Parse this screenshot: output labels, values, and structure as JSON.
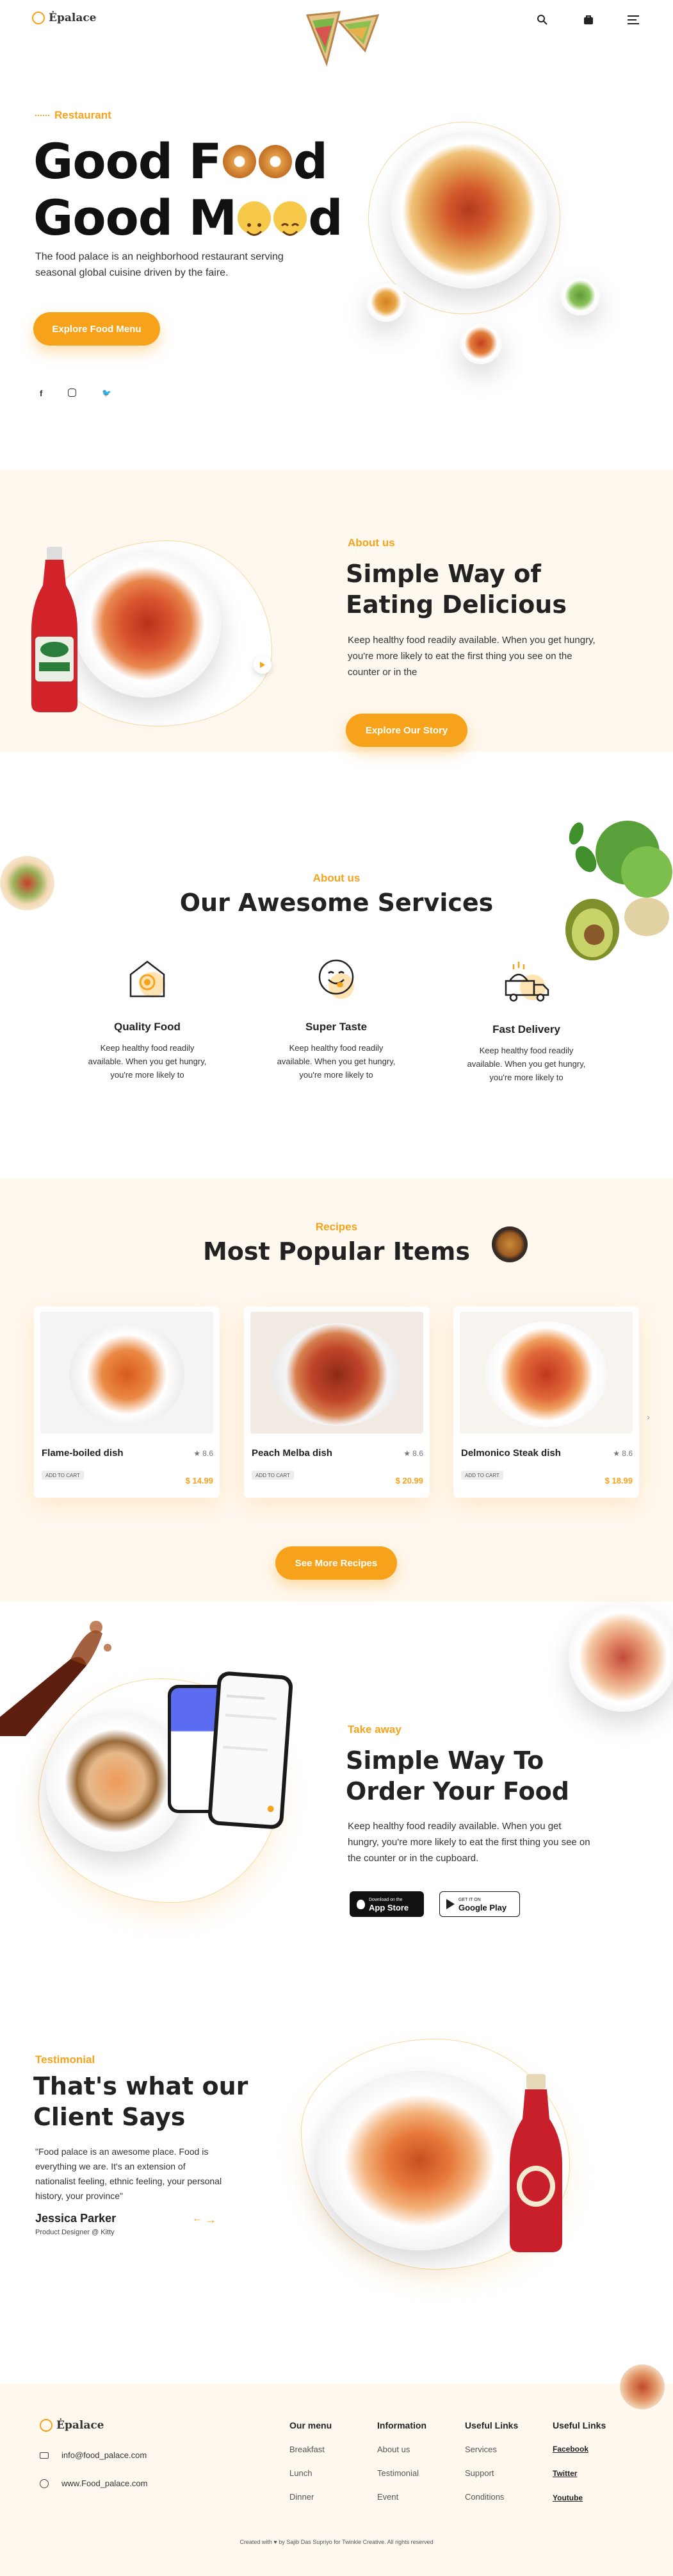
{
  "header": {
    "logo_text": "Ėpalace",
    "icons": [
      "search-icon",
      "bag-icon",
      "menu-icon"
    ]
  },
  "hero": {
    "eyebrow": "Restaurant",
    "title_line1_a": "Good F",
    "title_line1_b": "d",
    "title_line2_a": "Good M",
    "title_line2_b": "d",
    "description": "The food palace is an neighborhood restaurant serving seasonal global cuisine driven by the faire.",
    "cta": "Explore Food Menu",
    "social": [
      "facebook-icon",
      "instagram-icon",
      "twitter-icon"
    ]
  },
  "about": {
    "eyebrow": "About us",
    "title_line1": "Simple Way of",
    "title_line2": "Eating Delicious",
    "description": "Keep healthy food readily available. When you get hungry, you're more likely to eat the first thing you see on the counter or in the",
    "cta": "Explore Our Story"
  },
  "services": {
    "eyebrow": "About us",
    "title": "Our Awesome Services",
    "items": [
      {
        "title": "Quality Food",
        "text": "Keep healthy food readily available. When you get hungry, you're more likely to"
      },
      {
        "title": "Super Taste",
        "text": "Keep healthy food readily available. When you get hungry, you're more likely to"
      },
      {
        "title": "Fast Delivery",
        "text": "Keep healthy food readily available. When you get hungry, you're more likely to"
      }
    ]
  },
  "recipes": {
    "eyebrow": "Recipes",
    "title": "Most Popular Items",
    "items": [
      {
        "name": "Flame-boiled dish",
        "rating": "★ 8.6",
        "button": "ADD TO CART",
        "price": "$ 14.99"
      },
      {
        "name": "Peach Melba dish",
        "rating": "★ 8.6",
        "button": "ADD TO CART",
        "price": "$ 20.99"
      },
      {
        "name": "Delmonico Steak dish",
        "rating": "★ 8.6",
        "button": "ADD TO CART",
        "price": "$ 18.99"
      }
    ],
    "cta": "See More Recipes"
  },
  "takeaway": {
    "eyebrow": "Take away",
    "title_line1": "Simple Way To",
    "title_line2": "Order Your Food",
    "description": "Keep healthy food readily available. When you get hungry, you're more likely to eat the first thing you see on the counter or in the cupboard.",
    "appstore_small": "Download on the",
    "appstore_big": "App Store",
    "googleplay_small": "GET IT ON",
    "googleplay_big": "Google Play"
  },
  "testimonial": {
    "eyebrow": "Testimonial",
    "title_line1": "That's what our",
    "title_line2": "Client Says",
    "quote": "\"Food palace is an awesome place. Food is everything we are. It's an extension of nationalist feeling, ethnic feeling, your personal history, your province\"",
    "name": "Jessica Parker",
    "role": "Product Designer @ Kitty"
  },
  "footer": {
    "logo_text": "Ėpalace",
    "email": "info@food_palace.com",
    "website": "www.Food_palace.com",
    "columns": [
      {
        "title": "Our menu",
        "links": [
          "Breakfast",
          "Lunch",
          "Dinner"
        ]
      },
      {
        "title": "Information",
        "links": [
          "About us",
          "Testimonial",
          "Event"
        ]
      },
      {
        "title": "Useful Links",
        "links": [
          "Services",
          "Support",
          "Conditions"
        ]
      },
      {
        "title": "Useful Links",
        "links": [
          "Facebook",
          "Twitter",
          "Youtube"
        ]
      }
    ],
    "credit": "Created with ♥ by Sajib Das Supriyo for Twinkle Creative. All rights reserved"
  },
  "colors": {
    "accent": "#f7a21b",
    "cream": "#fff8ef"
  }
}
